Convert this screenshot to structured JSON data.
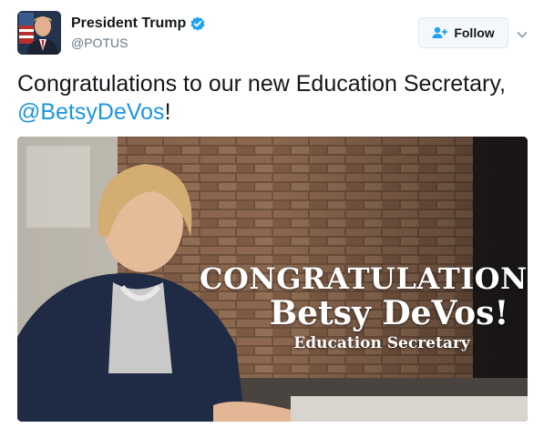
{
  "author": {
    "display_name": "President Trump",
    "handle": "@POTUS",
    "verified": true,
    "avatar_icon": "avatar-portrait"
  },
  "follow_button": {
    "label": "Follow",
    "icon": "follow-user-icon"
  },
  "menu_caret": {
    "icon": "chevron-down-icon"
  },
  "tweet": {
    "text_part1": "Congratulations to our new Education Secretary,",
    "mention": "@BetsyDeVos",
    "text_part2": "!"
  },
  "media": {
    "overlay_line1": "CONGRATULATIONS",
    "overlay_line2": "Betsy DeVos!",
    "overlay_line3": "Education Secretary"
  },
  "colors": {
    "link": "#1b95e0",
    "verified": "#1da1f2",
    "text": "#14171a",
    "secondary": "#657786"
  }
}
